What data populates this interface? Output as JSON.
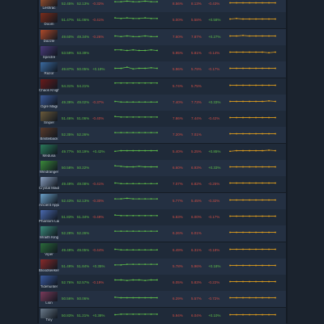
{
  "colors": {
    "background": "#1b232e",
    "row_even": "#243042",
    "row_odd": "#1f2a39",
    "positive": "#5fbf4a",
    "negative": "#d04e45",
    "sparkline_left": "#5fbf4a",
    "sparkline_right": "#e2a01e"
  },
  "rows": [
    {
      "hero": "Leshrac",
      "c": [
        "52.45%",
        "52.13%",
        "-0.32%"
      ],
      "r": [
        "8.56%",
        "8.13%",
        "-0.43%"
      ],
      "s1": [
        0.52,
        0.52,
        0.53,
        0.52,
        0.52,
        0.53,
        0.52,
        0.52
      ],
      "s2": [
        0.5,
        0.5,
        0.5,
        0.5,
        0.5,
        0.5,
        0.5,
        0.5
      ],
      "icon": "#a0522d"
    },
    {
      "hero": "Doom",
      "c": [
        "51.47%",
        "51.06%",
        "-0.41%"
      ],
      "r": [
        "5.00%",
        "5.58%",
        "+0.58%"
      ],
      "s1": [
        0.52,
        0.51,
        0.52,
        0.51,
        0.51,
        0.52,
        0.51,
        0.51
      ],
      "s2": [
        0.5,
        0.51,
        0.5,
        0.5,
        0.5,
        0.5,
        0.5,
        0.5
      ],
      "icon": "#7a2c1a"
    },
    {
      "hero": "Dazzle",
      "c": [
        "49.60%",
        "49.34%",
        "-0.26%"
      ],
      "r": [
        "7.60%",
        "7.87%",
        "+0.27%"
      ],
      "s1": [
        0.5,
        0.49,
        0.5,
        0.49,
        0.49,
        0.5,
        0.49,
        0.49
      ],
      "s2": [
        0.5,
        0.5,
        0.51,
        0.5,
        0.5,
        0.5,
        0.5,
        0.5
      ],
      "icon": "#b04a2a"
    },
    {
      "hero": "Spectre",
      "c": [
        "53.59%",
        "53.39%",
        ""
      ],
      "r": [
        "5.95%",
        "5.81%",
        "-0.14%"
      ],
      "s1": [
        0.54,
        0.54,
        0.53,
        0.54,
        0.53,
        0.53,
        0.54,
        0.53
      ],
      "s2": [
        0.5,
        0.5,
        0.5,
        0.5,
        0.5,
        0.5,
        0.49,
        0.5
      ],
      "icon": "#4a3a7a"
    },
    {
      "hero": "Razor",
      "c": [
        "49.87%",
        "50.05%",
        "+0.18%"
      ],
      "r": [
        "5.96%",
        "5.79%",
        "-0.17%"
      ],
      "s1": [
        0.5,
        0.5,
        0.52,
        0.49,
        0.5,
        0.5,
        0.51,
        0.5
      ],
      "s2": [
        0.5,
        0.5,
        0.5,
        0.5,
        0.5,
        0.5,
        0.5,
        0.5
      ],
      "icon": "#3a6aa0"
    },
    {
      "hero": "Chaos Knight",
      "c": [
        "54.31%",
        "54.21%",
        ""
      ],
      "r": [
        "5.74%",
        "5.75%",
        ""
      ],
      "s1": [
        0.54,
        0.54,
        0.54,
        0.54,
        0.54,
        0.54,
        0.54,
        0.54
      ],
      "s2": [
        0.5,
        0.5,
        0.5,
        0.5,
        0.5,
        0.5,
        0.5,
        0.5
      ],
      "icon": "#6a1a1a"
    },
    {
      "hero": "Ogre Magi",
      "c": [
        "49.39%",
        "49.02%",
        "-0.37%"
      ],
      "r": [
        "7.40%",
        "7.73%",
        "+0.33%"
      ],
      "s1": [
        0.5,
        0.49,
        0.49,
        0.49,
        0.49,
        0.49,
        0.49,
        0.49
      ],
      "s2": [
        0.5,
        0.5,
        0.5,
        0.5,
        0.5,
        0.5,
        0.51,
        0.5
      ],
      "icon": "#3a5a9a"
    },
    {
      "hero": "Sniper",
      "c": [
        "51.46%",
        "51.06%",
        "-0.40%"
      ],
      "r": [
        "7.86%",
        "7.44%",
        "-0.42%"
      ],
      "s1": [
        0.52,
        0.51,
        0.51,
        0.51,
        0.51,
        0.51,
        0.51,
        0.51
      ],
      "s2": [
        0.5,
        0.5,
        0.5,
        0.5,
        0.5,
        0.5,
        0.5,
        0.5
      ],
      "icon": "#6a5a3a"
    },
    {
      "hero": "Bristleback",
      "c": [
        "52.35%",
        "52.26%",
        ""
      ],
      "r": [
        "7.20%",
        "7.01%",
        ""
      ],
      "s1": [
        0.52,
        0.52,
        0.52,
        0.52,
        0.52,
        0.52,
        0.52,
        0.52
      ],
      "s2": [
        0.5,
        0.5,
        0.5,
        0.5,
        0.5,
        0.5,
        0.5,
        0.5
      ],
      "icon": "#5a3a2a"
    },
    {
      "hero": "Medusa",
      "c": [
        "49.77%",
        "50.19%",
        "+0.42%"
      ],
      "r": [
        "5.40%",
        "5.25%",
        "+0.85%"
      ],
      "s1": [
        0.49,
        0.5,
        0.5,
        0.5,
        0.5,
        0.5,
        0.5,
        0.5
      ],
      "s2": [
        0.49,
        0.5,
        0.5,
        0.5,
        0.5,
        0.5,
        0.51,
        0.5
      ],
      "icon": "#2a7a5a"
    },
    {
      "hero": "Windranger",
      "c": [
        "50.58%",
        "50.22%",
        ""
      ],
      "r": [
        "6.60%",
        "6.93%",
        "+0.33%"
      ],
      "s1": [
        0.52,
        0.51,
        0.5,
        0.5,
        0.51,
        0.5,
        0.5,
        0.5
      ],
      "s2": [
        0.5,
        0.5,
        0.5,
        0.5,
        0.5,
        0.5,
        0.5,
        0.5
      ],
      "icon": "#3a8a3a"
    },
    {
      "hero": "Crystal Maiden",
      "c": [
        "49.49%",
        "49.08%",
        "-0.41%"
      ],
      "r": [
        "7.07%",
        "6.82%",
        "-0.25%"
      ],
      "s1": [
        0.5,
        0.49,
        0.49,
        0.49,
        0.49,
        0.49,
        0.49,
        0.49
      ],
      "s2": [
        0.5,
        0.5,
        0.5,
        0.5,
        0.5,
        0.5,
        0.5,
        0.5
      ],
      "icon": "#8aa0c0"
    },
    {
      "hero": "Ancient Apparition",
      "c": [
        "52.43%",
        "52.13%",
        "-0.30%"
      ],
      "r": [
        "5.77%",
        "5.45%",
        "-0.32%"
      ],
      "s1": [
        0.52,
        0.52,
        0.53,
        0.52,
        0.52,
        0.52,
        0.52,
        0.52
      ],
      "s2": [
        0.5,
        0.5,
        0.5,
        0.5,
        0.5,
        0.5,
        0.5,
        0.5
      ],
      "icon": "#6aa0c8"
    },
    {
      "hero": "Phantom Lancer",
      "c": [
        "51.83%",
        "51.34%",
        "-0.49%"
      ],
      "r": [
        "5.83%",
        "6.00%",
        "-0.17%"
      ],
      "s1": [
        0.52,
        0.51,
        0.51,
        0.51,
        0.51,
        0.51,
        0.51,
        0.51
      ],
      "s2": [
        0.5,
        0.5,
        0.5,
        0.5,
        0.5,
        0.5,
        0.5,
        0.5
      ],
      "icon": "#4a6ab0"
    },
    {
      "hero": "Wraith King",
      "c": [
        "52.28%",
        "52.26%",
        ""
      ],
      "r": [
        "6.26%",
        "6.01%",
        ""
      ],
      "s1": [
        0.52,
        0.52,
        0.52,
        0.52,
        0.52,
        0.52,
        0.52,
        0.52
      ],
      "s2": [
        0.5,
        0.5,
        0.5,
        0.5,
        0.5,
        0.5,
        0.5,
        0.5
      ],
      "icon": "#3a8a7a"
    },
    {
      "hero": "Viper",
      "c": [
        "49.49%",
        "49.05%",
        "-0.44%"
      ],
      "r": [
        "6.49%",
        "6.31%",
        "-0.18%"
      ],
      "s1": [
        0.5,
        0.49,
        0.49,
        0.49,
        0.49,
        0.49,
        0.49,
        0.49
      ],
      "s2": [
        0.5,
        0.5,
        0.5,
        0.5,
        0.5,
        0.5,
        0.5,
        0.5
      ],
      "icon": "#2a6a3a"
    },
    {
      "hero": "Bloodseeker",
      "c": [
        "51.49%",
        "51.84%",
        "+0.35%"
      ],
      "r": [
        "5.78%",
        "5.96%",
        "+0.18%"
      ],
      "s1": [
        0.51,
        0.51,
        0.52,
        0.52,
        0.52,
        0.52,
        0.52,
        0.52
      ],
      "s2": [
        0.5,
        0.5,
        0.5,
        0.5,
        0.5,
        0.5,
        0.5,
        0.5
      ],
      "icon": "#8a2a2a"
    },
    {
      "hero": "Tidehunter",
      "c": [
        "52.76%",
        "52.57%",
        "-0.19%"
      ],
      "r": [
        "6.05%",
        "5.83%",
        "-0.22%"
      ],
      "s1": [
        0.53,
        0.53,
        0.52,
        0.53,
        0.53,
        0.52,
        0.53,
        0.53
      ],
      "s2": [
        0.5,
        0.5,
        0.5,
        0.5,
        0.5,
        0.5,
        0.5,
        0.5
      ],
      "icon": "#3a5aa0"
    },
    {
      "hero": "Lion",
      "c": [
        "50.56%",
        "50.06%",
        ""
      ],
      "r": [
        "6.29%",
        "5.57%",
        "-0.72%"
      ],
      "s1": [
        0.51,
        0.5,
        0.5,
        0.5,
        0.5,
        0.5,
        0.5,
        0.5
      ],
      "s2": [
        0.5,
        0.5,
        0.5,
        0.5,
        0.5,
        0.5,
        0.5,
        0.5
      ],
      "icon": "#7a3a5a"
    },
    {
      "hero": "Tiny",
      "c": [
        "50.83%",
        "51.21%",
        "+0.38%"
      ],
      "r": [
        "5.94%",
        "6.04%",
        "+0.10%"
      ],
      "s1": [
        0.5,
        0.51,
        0.51,
        0.51,
        0.51,
        0.51,
        0.51,
        0.51
      ],
      "s2": [
        0.5,
        0.5,
        0.5,
        0.5,
        0.5,
        0.5,
        0.5,
        0.5
      ],
      "icon": "#6a7a8a"
    }
  ]
}
